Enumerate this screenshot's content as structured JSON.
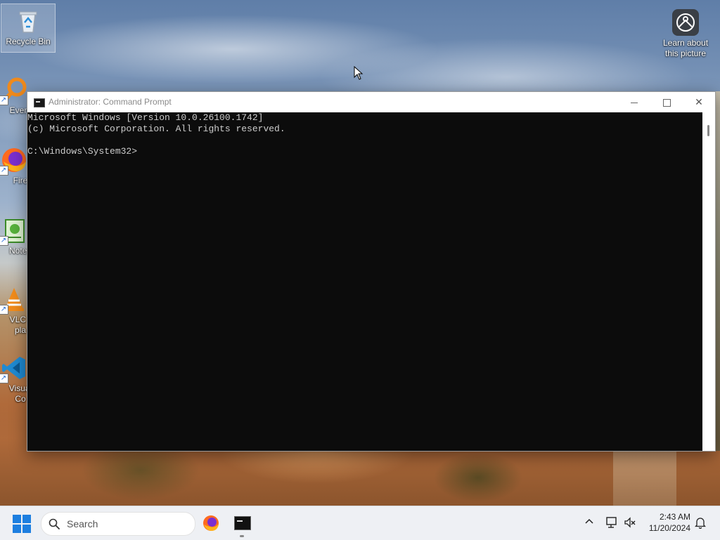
{
  "desktop": {
    "icons": [
      {
        "label": "Recycle Bin",
        "icon": "recycle-bin-icon"
      },
      {
        "label": "Every",
        "icon": "everything-search-icon"
      },
      {
        "label": "Fire",
        "icon": "firefox-icon"
      },
      {
        "label": "Notep",
        "icon": "notepad-icon"
      },
      {
        "label": "VLC r",
        "label2": "pla",
        "icon": "vlc-icon"
      },
      {
        "label": "Visual",
        "label2": "Co",
        "icon": "vscode-icon"
      },
      {
        "label": "Learn about",
        "label2": "this picture",
        "icon": "learn-about-picture-icon"
      }
    ]
  },
  "window": {
    "title": "Administrator: Command Prompt",
    "console_lines": [
      "Microsoft Windows [Version 10.0.26100.1742]",
      "(c) Microsoft Corporation. All rights reserved.",
      "",
      "C:\\Windows\\System32>"
    ]
  },
  "taskbar": {
    "search_placeholder": "Search",
    "time": "2:43 AM",
    "date": "11/20/2024"
  },
  "colors": {
    "console_bg": "#0c0c0c",
    "console_fg": "#cccccc",
    "taskbar_bg": "#eef0f4",
    "accent": "#1d7fe0"
  }
}
